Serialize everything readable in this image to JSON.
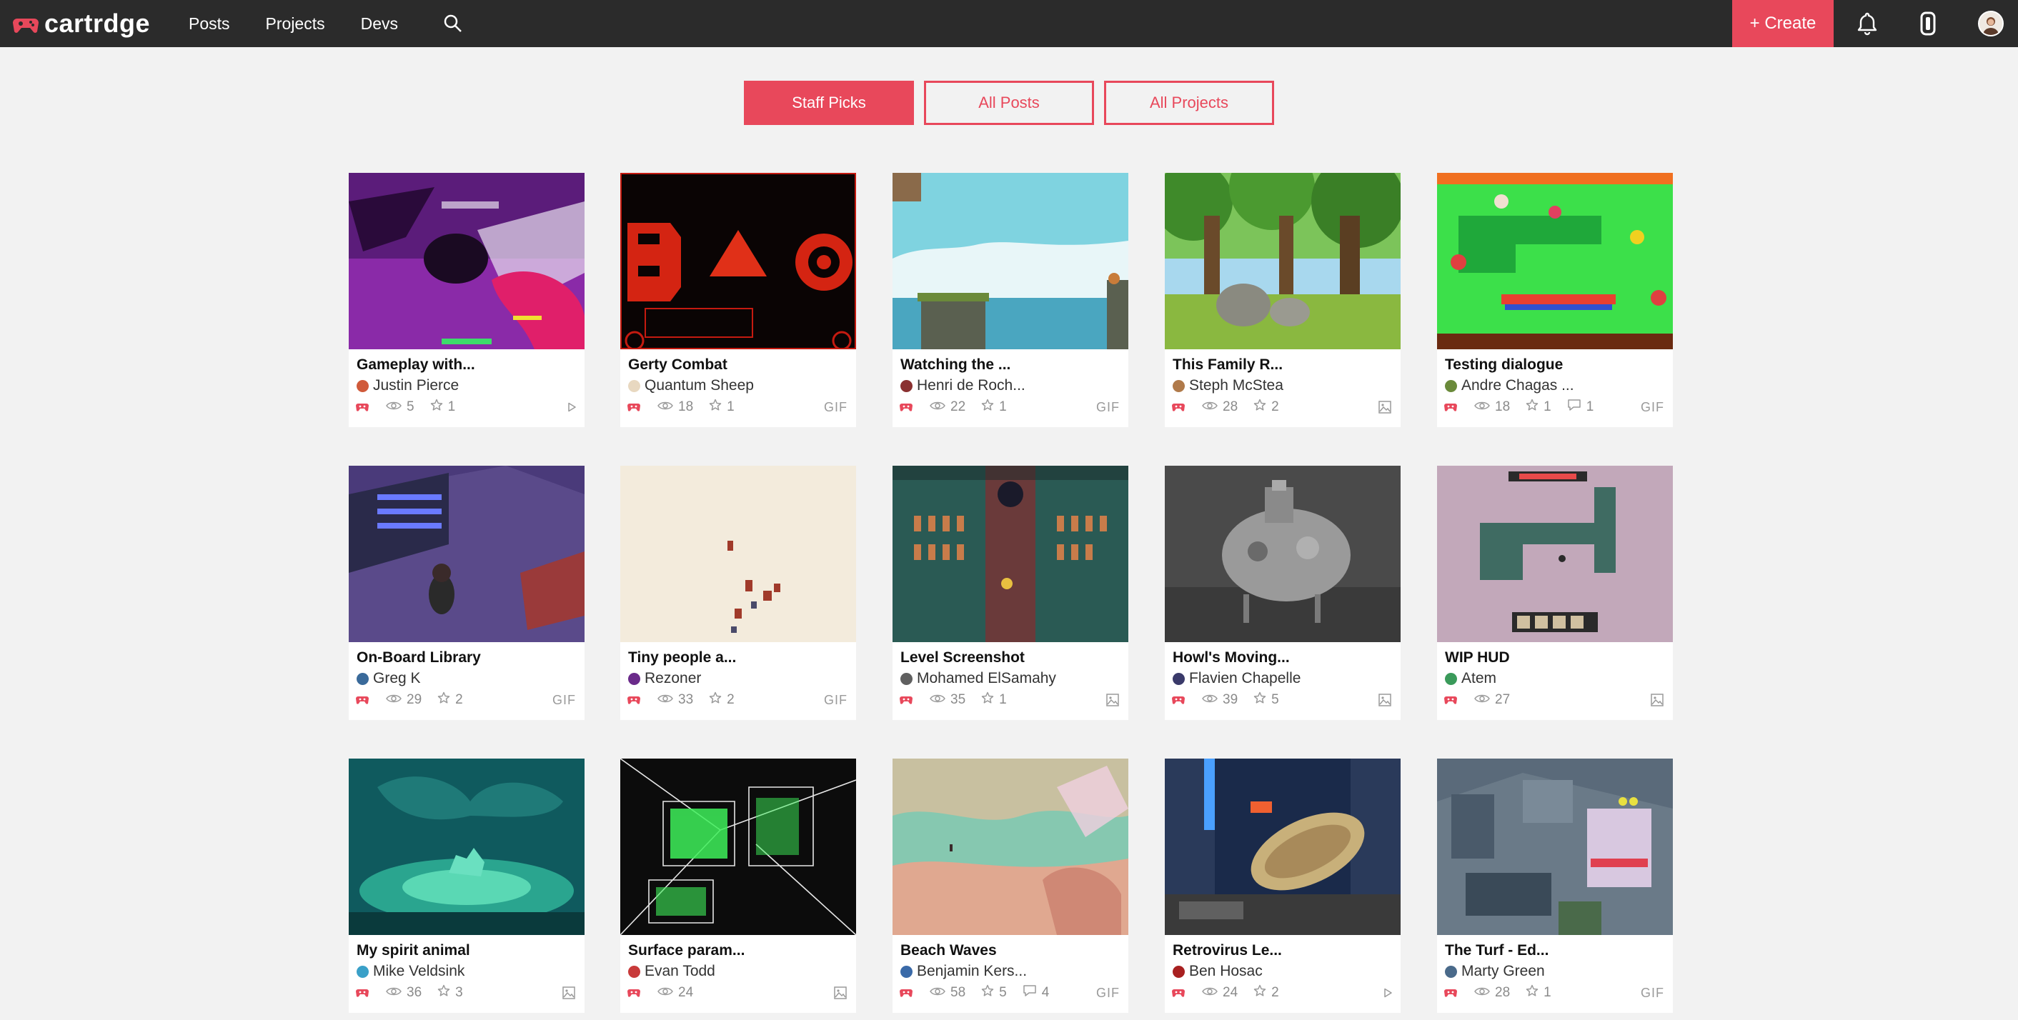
{
  "app": {
    "name": "cartrdge"
  },
  "nav": {
    "links": [
      "Posts",
      "Projects",
      "Devs"
    ],
    "create_label": "+ Create"
  },
  "tabs": [
    {
      "label": "Staff Picks",
      "active": true
    },
    {
      "label": "All Posts",
      "active": false
    },
    {
      "label": "All Projects",
      "active": false
    }
  ],
  "colors": {
    "accent": "#e8485b",
    "nav_bg": "#2b2b2b",
    "page_bg": "#f2f2f2"
  },
  "cards": [
    {
      "title": "Gameplay with...",
      "author": "Justin Pierce",
      "views": "5",
      "stars": "1",
      "comments": "",
      "type": "video",
      "badge": ""
    },
    {
      "title": "Gerty Combat",
      "author": "Quantum Sheep",
      "views": "18",
      "stars": "1",
      "comments": "",
      "type": "gif",
      "badge": "GIF"
    },
    {
      "title": "Watching the ...",
      "author": "Henri de Roch...",
      "views": "22",
      "stars": "1",
      "comments": "",
      "type": "gif",
      "badge": "GIF"
    },
    {
      "title": "This Family R...",
      "author": "Steph McStea",
      "views": "28",
      "stars": "2",
      "comments": "",
      "type": "image",
      "badge": ""
    },
    {
      "title": "Testing dialogue",
      "author": "Andre Chagas ...",
      "views": "18",
      "stars": "1",
      "comments": "1",
      "type": "gif",
      "badge": "GIF"
    },
    {
      "title": "On-Board Library",
      "author": "Greg K",
      "views": "29",
      "stars": "2",
      "comments": "",
      "type": "gif",
      "badge": "GIF"
    },
    {
      "title": "Tiny people a...",
      "author": "Rezoner",
      "views": "33",
      "stars": "2",
      "comments": "",
      "type": "gif",
      "badge": "GIF"
    },
    {
      "title": "Level Screenshot",
      "author": "Mohamed ElSamahy",
      "views": "35",
      "stars": "1",
      "comments": "",
      "type": "image",
      "badge": ""
    },
    {
      "title": "Howl's Moving...",
      "author": "Flavien Chapelle",
      "views": "39",
      "stars": "5",
      "comments": "",
      "type": "image",
      "badge": ""
    },
    {
      "title": "WIP HUD",
      "author": "Atem",
      "views": "27",
      "stars": "",
      "comments": "",
      "type": "image",
      "badge": ""
    },
    {
      "title": "My spirit animal",
      "author": "Mike Veldsink",
      "views": "36",
      "stars": "3",
      "comments": "",
      "type": "image",
      "badge": ""
    },
    {
      "title": "Surface param...",
      "author": "Evan Todd",
      "views": "24",
      "stars": "",
      "comments": "",
      "type": "image",
      "badge": ""
    },
    {
      "title": "Beach Waves",
      "author": "Benjamin Kers...",
      "views": "58",
      "stars": "5",
      "comments": "4",
      "type": "gif",
      "badge": "GIF"
    },
    {
      "title": "Retrovirus Le...",
      "author": "Ben Hosac",
      "views": "24",
      "stars": "2",
      "comments": "",
      "type": "video",
      "badge": ""
    },
    {
      "title": "The Turf - Ed...",
      "author": "Marty Green",
      "views": "28",
      "stars": "1",
      "comments": "",
      "type": "gif",
      "badge": "GIF"
    }
  ]
}
